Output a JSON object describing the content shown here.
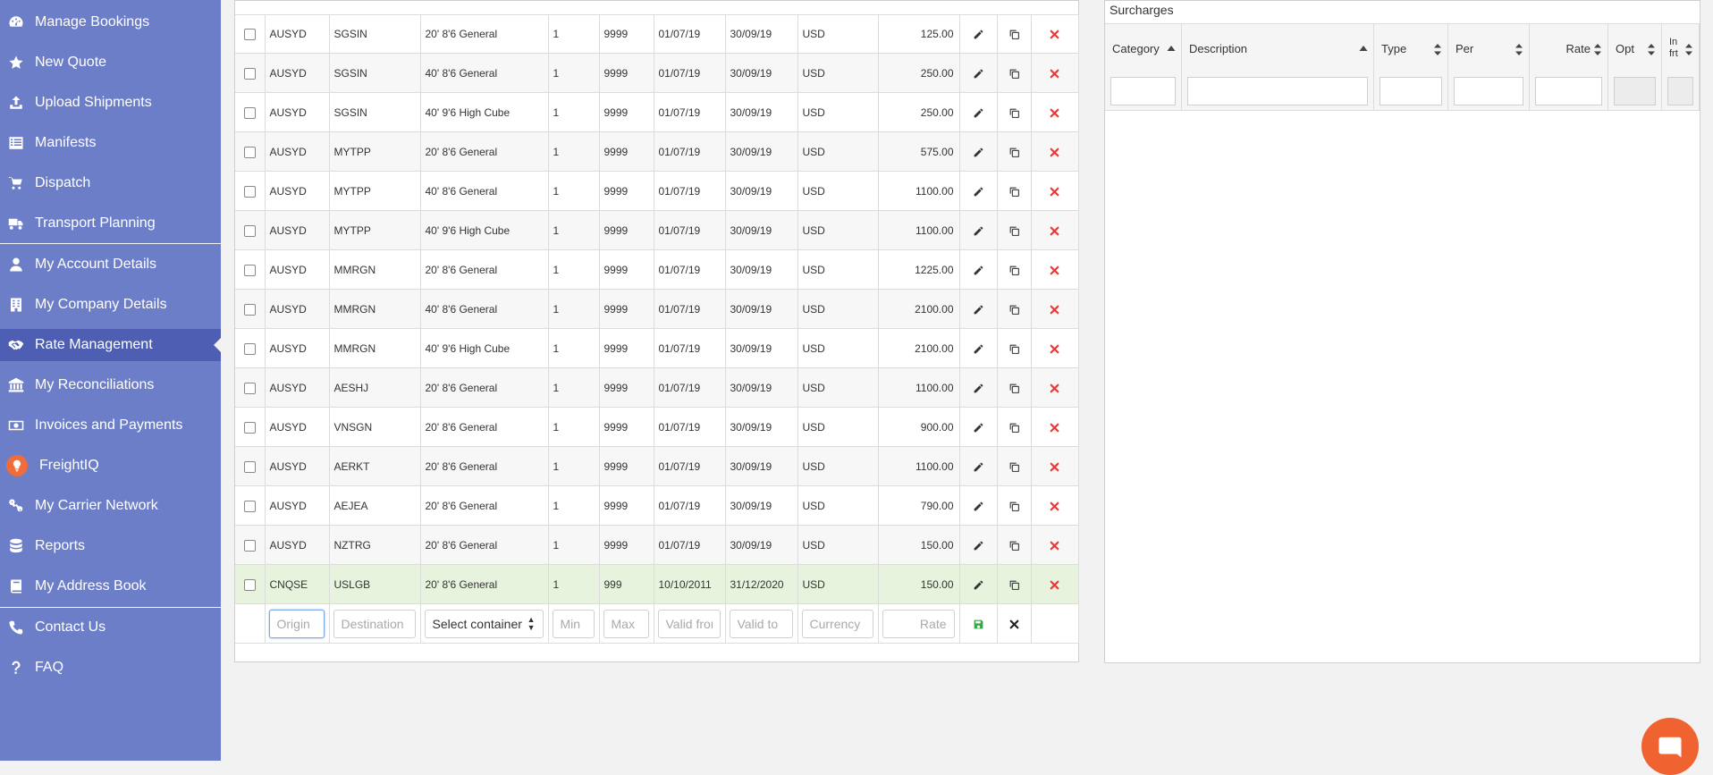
{
  "sidebar": {
    "items": [
      {
        "label": "Manage Bookings",
        "icon": "dashboard-icon"
      },
      {
        "label": "New Quote",
        "icon": "star-icon"
      },
      {
        "label": "Upload Shipments",
        "icon": "upload-icon"
      },
      {
        "label": "Manifests",
        "icon": "list-icon"
      },
      {
        "label": "Dispatch",
        "icon": "cart-icon"
      },
      {
        "label": "Transport Planning",
        "icon": "truck-icon"
      },
      {
        "label": "My Account Details",
        "icon": "user-icon"
      },
      {
        "label": "My Company Details",
        "icon": "building-icon"
      },
      {
        "label": "Rate Management",
        "icon": "handshake-icon"
      },
      {
        "label": "My Reconciliations",
        "icon": "bank-icon"
      },
      {
        "label": "Invoices and Payments",
        "icon": "money-icon"
      },
      {
        "label": "FreightIQ",
        "icon": "lightbulb-icon"
      },
      {
        "label": "My Carrier Network",
        "icon": "link-icon"
      },
      {
        "label": "Reports",
        "icon": "database-icon"
      },
      {
        "label": "My Address Book",
        "icon": "book-icon"
      },
      {
        "label": "Contact Us",
        "icon": "phone-icon"
      },
      {
        "label": "FAQ",
        "icon": "question-icon"
      }
    ],
    "active": "Rate Management"
  },
  "rates": {
    "rows": [
      {
        "origin": "AUSYD",
        "dest": "SGSIN",
        "container": "20' 8'6 General",
        "min": "1",
        "max": "9999",
        "from": "01/07/19",
        "to": "30/09/19",
        "currency": "USD",
        "rate": "125.00"
      },
      {
        "origin": "AUSYD",
        "dest": "SGSIN",
        "container": "40' 8'6 General",
        "min": "1",
        "max": "9999",
        "from": "01/07/19",
        "to": "30/09/19",
        "currency": "USD",
        "rate": "250.00"
      },
      {
        "origin": "AUSYD",
        "dest": "SGSIN",
        "container": "40' 9'6 High Cube",
        "min": "1",
        "max": "9999",
        "from": "01/07/19",
        "to": "30/09/19",
        "currency": "USD",
        "rate": "250.00"
      },
      {
        "origin": "AUSYD",
        "dest": "MYTPP",
        "container": "20' 8'6 General",
        "min": "1",
        "max": "9999",
        "from": "01/07/19",
        "to": "30/09/19",
        "currency": "USD",
        "rate": "575.00"
      },
      {
        "origin": "AUSYD",
        "dest": "MYTPP",
        "container": "40' 8'6 General",
        "min": "1",
        "max": "9999",
        "from": "01/07/19",
        "to": "30/09/19",
        "currency": "USD",
        "rate": "1100.00"
      },
      {
        "origin": "AUSYD",
        "dest": "MYTPP",
        "container": "40' 9'6 High Cube",
        "min": "1",
        "max": "9999",
        "from": "01/07/19",
        "to": "30/09/19",
        "currency": "USD",
        "rate": "1100.00"
      },
      {
        "origin": "AUSYD",
        "dest": "MMRGN",
        "container": "20' 8'6 General",
        "min": "1",
        "max": "9999",
        "from": "01/07/19",
        "to": "30/09/19",
        "currency": "USD",
        "rate": "1225.00"
      },
      {
        "origin": "AUSYD",
        "dest": "MMRGN",
        "container": "40' 8'6 General",
        "min": "1",
        "max": "9999",
        "from": "01/07/19",
        "to": "30/09/19",
        "currency": "USD",
        "rate": "2100.00"
      },
      {
        "origin": "AUSYD",
        "dest": "MMRGN",
        "container": "40' 9'6 High Cube",
        "min": "1",
        "max": "9999",
        "from": "01/07/19",
        "to": "30/09/19",
        "currency": "USD",
        "rate": "2100.00"
      },
      {
        "origin": "AUSYD",
        "dest": "AESHJ",
        "container": "20' 8'6 General",
        "min": "1",
        "max": "9999",
        "from": "01/07/19",
        "to": "30/09/19",
        "currency": "USD",
        "rate": "1100.00"
      },
      {
        "origin": "AUSYD",
        "dest": "VNSGN",
        "container": "20' 8'6 General",
        "min": "1",
        "max": "9999",
        "from": "01/07/19",
        "to": "30/09/19",
        "currency": "USD",
        "rate": "900.00"
      },
      {
        "origin": "AUSYD",
        "dest": "AERKT",
        "container": "20' 8'6 General",
        "min": "1",
        "max": "9999",
        "from": "01/07/19",
        "to": "30/09/19",
        "currency": "USD",
        "rate": "1100.00"
      },
      {
        "origin": "AUSYD",
        "dest": "AEJEA",
        "container": "20' 8'6 General",
        "min": "1",
        "max": "9999",
        "from": "01/07/19",
        "to": "30/09/19",
        "currency": "USD",
        "rate": "790.00"
      },
      {
        "origin": "AUSYD",
        "dest": "NZTRG",
        "container": "20' 8'6 General",
        "min": "1",
        "max": "9999",
        "from": "01/07/19",
        "to": "30/09/19",
        "currency": "USD",
        "rate": "150.00"
      },
      {
        "origin": "CNQSE",
        "dest": "USLGB",
        "container": "20' 8'6 General",
        "min": "1",
        "max": "999",
        "from": "10/10/2011",
        "to": "31/12/2020",
        "currency": "USD",
        "rate": "150.00",
        "highlight": true
      }
    ],
    "new_row": {
      "origin_placeholder": "Origin",
      "dest_placeholder": "Destination",
      "container_select": "Select container",
      "min_placeholder": "Min",
      "max_placeholder": "Max",
      "from_placeholder": "Valid from",
      "to_placeholder": "Valid to",
      "currency_placeholder": "Currency",
      "rate_placeholder": "Rate"
    }
  },
  "surcharges": {
    "title": "Surcharges",
    "columns": [
      {
        "label": "Category",
        "sort": "up"
      },
      {
        "label": "Description",
        "sort": "up"
      },
      {
        "label": "Type",
        "sort": "both"
      },
      {
        "label": "Per",
        "sort": "both"
      },
      {
        "label": "Rate",
        "sort": "both"
      },
      {
        "label": "Opt",
        "sort": "both"
      },
      {
        "label": "In frt",
        "sort": "both"
      }
    ]
  },
  "colors": {
    "sidebar_bg": "#6d7ec9",
    "sidebar_active": "#4e5fb3",
    "highlight_row": "#e7f3dd",
    "delete_red": "#e03b3b",
    "save_green": "#3aa64c",
    "chat_orange": "#f0622f"
  }
}
